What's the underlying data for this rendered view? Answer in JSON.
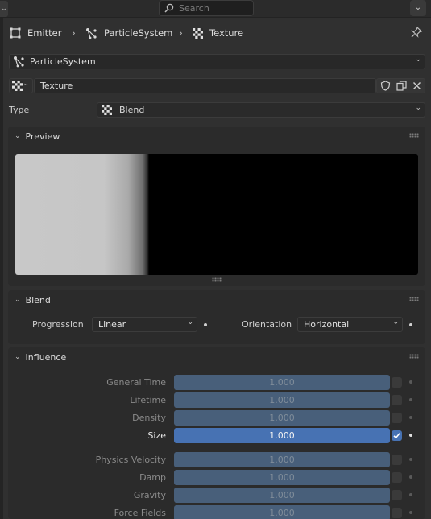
{
  "topbar": {
    "search_placeholder": "Search"
  },
  "breadcrumb": {
    "emitter": "Emitter",
    "particle_system": "ParticleSystem",
    "texture": "Texture"
  },
  "particle_system_selector": {
    "value": "ParticleSystem"
  },
  "texture_selector": {
    "value": "Texture"
  },
  "type_row": {
    "label": "Type",
    "value": "Blend"
  },
  "preview_panel": {
    "title": "Preview"
  },
  "blend_panel": {
    "title": "Blend",
    "progression_label": "Progression",
    "progression_value": "Linear",
    "orientation_label": "Orientation",
    "orientation_value": "Horizontal"
  },
  "influence_panel": {
    "title": "Influence",
    "rows": [
      {
        "label": "General Time",
        "value": "1.000",
        "enabled": false
      },
      {
        "label": "Lifetime",
        "value": "1.000",
        "enabled": false
      },
      {
        "label": "Density",
        "value": "1.000",
        "enabled": false
      },
      {
        "label": "Size",
        "value": "1.000",
        "enabled": true
      },
      {
        "label": "Physics Velocity",
        "value": "1.000",
        "enabled": false
      },
      {
        "label": "Damp",
        "value": "1.000",
        "enabled": false
      },
      {
        "label": "Gravity",
        "value": "1.000",
        "enabled": false
      },
      {
        "label": "Force Fields",
        "value": "1.000",
        "enabled": false
      }
    ]
  },
  "colors": {
    "accent": "#4772b3",
    "disabled_slider": "#485f7a",
    "background": "#303030"
  }
}
